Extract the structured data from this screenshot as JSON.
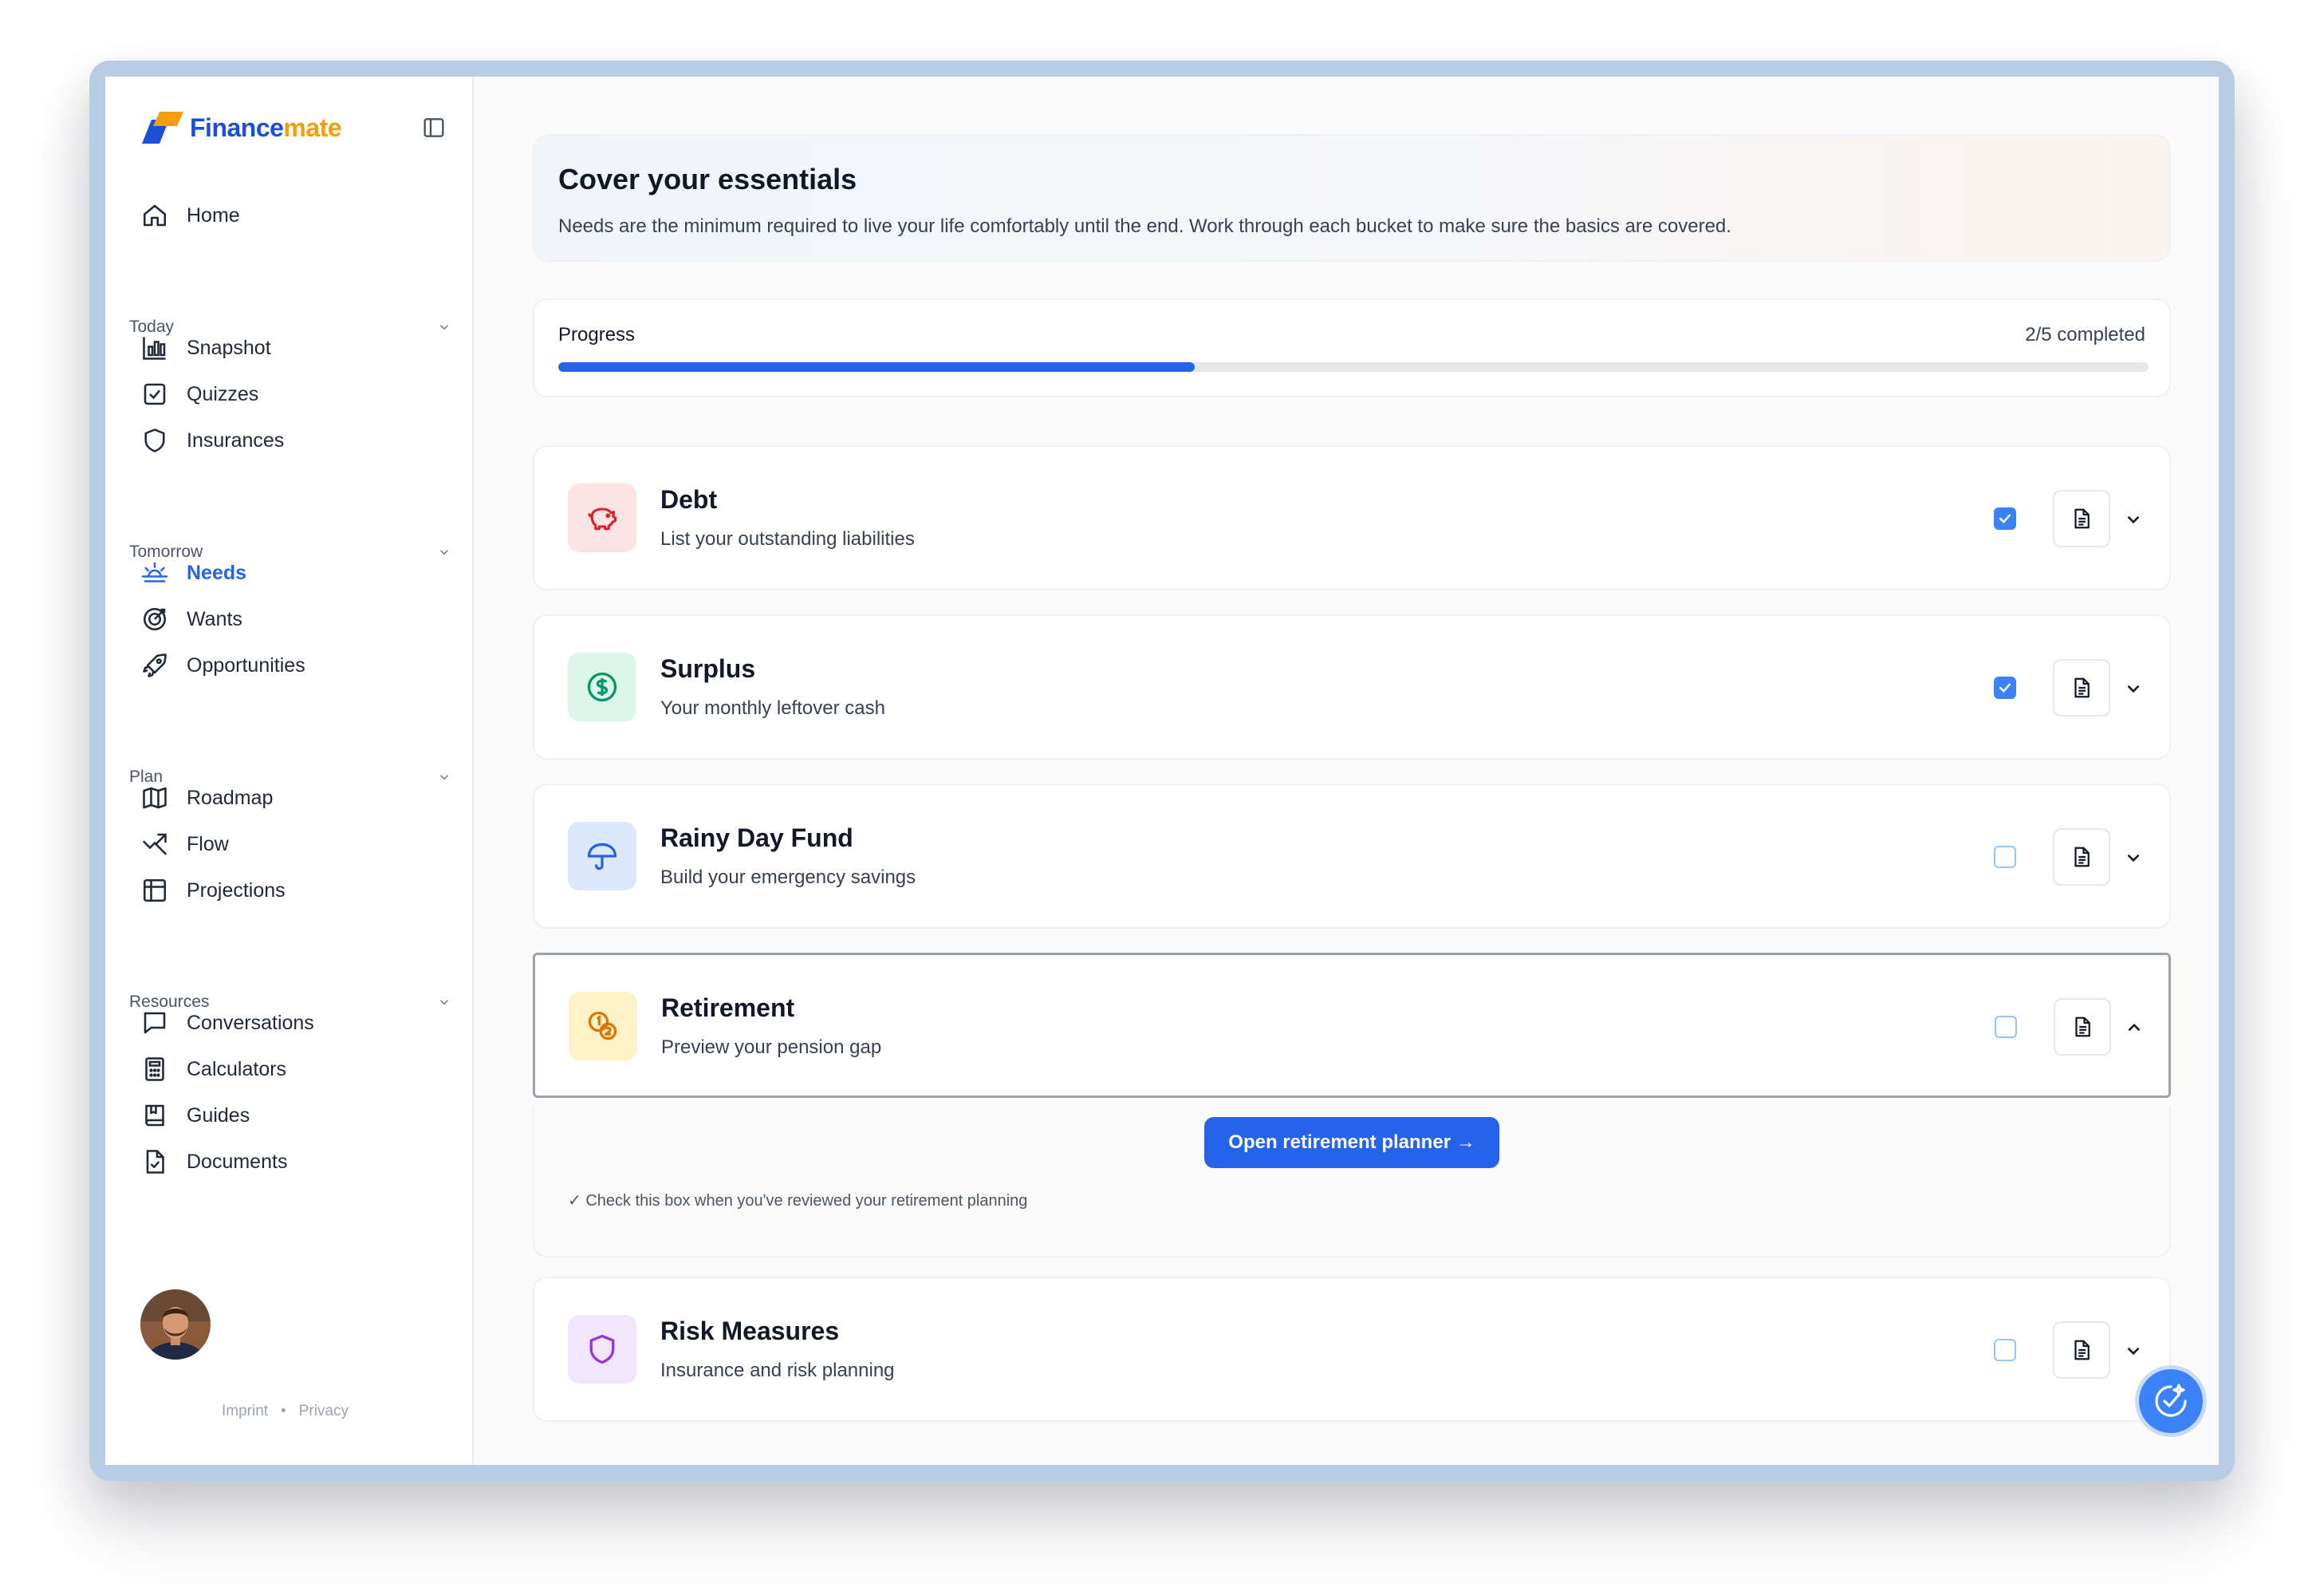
{
  "brand": {
    "name_part1": "Finance",
    "name_part2": "mate",
    "colors": {
      "primary": "#1d4ed8",
      "accent": "#f59e0b"
    }
  },
  "sidebar": {
    "home": {
      "label": "Home",
      "icon": "home-icon"
    },
    "sections": [
      {
        "label": "Today",
        "items": [
          {
            "label": "Snapshot",
            "icon": "bar-chart-icon"
          },
          {
            "label": "Quizzes",
            "icon": "checkbox-icon"
          },
          {
            "label": "Insurances",
            "icon": "shield-icon"
          }
        ]
      },
      {
        "label": "Tomorrow",
        "items": [
          {
            "label": "Needs",
            "icon": "sunrise-icon",
            "active": true
          },
          {
            "label": "Wants",
            "icon": "target-icon"
          },
          {
            "label": "Opportunities",
            "icon": "rocket-icon"
          }
        ]
      },
      {
        "label": "Plan",
        "items": [
          {
            "label": "Roadmap",
            "icon": "map-icon"
          },
          {
            "label": "Flow",
            "icon": "trend-icon"
          },
          {
            "label": "Projections",
            "icon": "table-icon"
          }
        ]
      },
      {
        "label": "Resources",
        "items": [
          {
            "label": "Conversations",
            "icon": "chat-icon"
          },
          {
            "label": "Calculators",
            "icon": "calculator-icon"
          },
          {
            "label": "Guides",
            "icon": "book-icon"
          },
          {
            "label": "Documents",
            "icon": "document-check-icon"
          }
        ]
      }
    ],
    "footer": {
      "imprint": "Imprint",
      "separator": "•",
      "privacy": "Privacy"
    }
  },
  "main": {
    "hero": {
      "title": "Cover your essentials",
      "subtitle": "Needs are the minimum required to live your life comfortably until the end. Work through each bucket to make sure the basics are covered."
    },
    "progress": {
      "label": "Progress",
      "count_text": "2/5 completed",
      "fraction": 0.4
    },
    "buckets": [
      {
        "title": "Debt",
        "subtitle": "List your outstanding liabilities",
        "icon": "piggy-bank-icon",
        "checked": true,
        "expanded": false,
        "icon_bg": "#fde4e4",
        "icon_color": "#e11d2a"
      },
      {
        "title": "Surplus",
        "subtitle": "Your monthly leftover cash",
        "icon": "dollar-circle-icon",
        "checked": true,
        "expanded": false,
        "icon_bg": "#dcf6ea",
        "icon_color": "#059669"
      },
      {
        "title": "Rainy Day Fund",
        "subtitle": "Build your emergency savings",
        "icon": "umbrella-icon",
        "checked": false,
        "expanded": false,
        "icon_bg": "#dde9fb",
        "icon_color": "#2563eb"
      },
      {
        "title": "Retirement",
        "subtitle": "Preview your pension gap",
        "icon": "coins-icon",
        "checked": false,
        "expanded": true,
        "icon_bg": "#fdf3c7",
        "icon_color": "#d97706"
      },
      {
        "title": "Risk Measures",
        "subtitle": "Insurance and risk planning",
        "icon": "shield-icon",
        "checked": false,
        "expanded": false,
        "icon_bg": "#f1e6fb",
        "icon_color": "#9333ea"
      }
    ],
    "retirement_panel": {
      "button_label": "Open retirement planner →",
      "hint": "✓ Check this box when you've reviewed your retirement planning"
    }
  }
}
